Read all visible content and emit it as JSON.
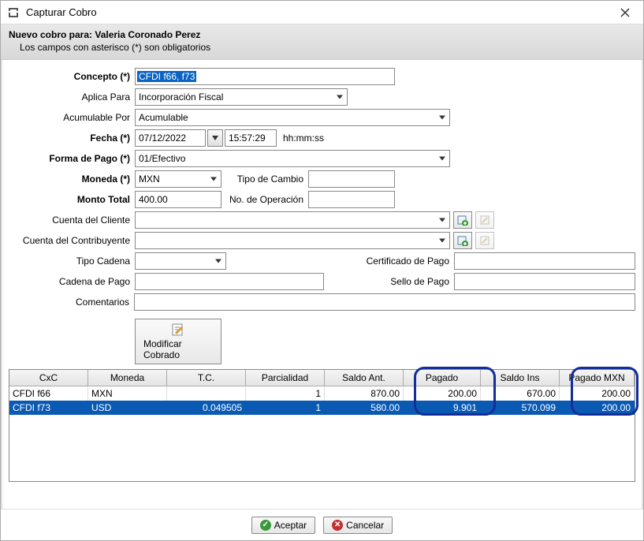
{
  "window": {
    "title": "Capturar Cobro"
  },
  "header": {
    "line1": "Nuevo cobro para: Valeria Coronado Perez",
    "line2": "Los campos con asterisco (*) son obligatorios"
  },
  "labels": {
    "concepto": "Concepto (*)",
    "aplica": "Aplica Para",
    "acum": "Acumulable Por",
    "fecha": "Fecha (*)",
    "hhmmss": "hh:mm:ss",
    "forma": "Forma de Pago (*)",
    "moneda": "Moneda (*)",
    "tipocambio": "Tipo de Cambio",
    "monto": "Monto Total",
    "noop": "No. de Operación",
    "cuentacli": "Cuenta del Cliente",
    "cuentacon": "Cuenta del Contribuyente",
    "tipocad": "Tipo Cadena",
    "certpago": "Certificado de Pago",
    "cadpago": "Cadena de Pago",
    "sellopago": "Sello de Pago",
    "coment": "Comentarios",
    "modificar": "Modificar Cobrado"
  },
  "values": {
    "concepto": "CFDI f66, f73",
    "aplica": "Incorporación Fiscal",
    "acum": "Acumulable",
    "fecha": "07/12/2022",
    "hora": "15:57:29",
    "forma": "01/Efectivo",
    "moneda": "MXN",
    "tipocambio": "",
    "monto": "400.00",
    "noop": "",
    "cuentacli": "",
    "cuentacon": "",
    "tipocad": "",
    "certpago": "",
    "cadpago": "",
    "sellopago": "",
    "coment": ""
  },
  "table": {
    "headers": [
      "CxC",
      "Moneda",
      "T.C.",
      "Parcialidad",
      "Saldo Ant.",
      "Pagado",
      "Saldo Ins",
      "Pagado MXN"
    ],
    "rows": [
      {
        "cxc": "CFDI f66",
        "moneda": "MXN",
        "tc": "",
        "par": "1",
        "sa": "870.00",
        "pag": "200.00",
        "si": "670.00",
        "pm": "200.00",
        "selected": false
      },
      {
        "cxc": "CFDI f73",
        "moneda": "USD",
        "tc": "0.049505",
        "par": "1",
        "sa": "580.00",
        "pag": "9.901",
        "si": "570.099",
        "pm": "200.00",
        "selected": true
      }
    ]
  },
  "footer": {
    "aceptar": "Aceptar",
    "cancelar": "Cancelar"
  }
}
